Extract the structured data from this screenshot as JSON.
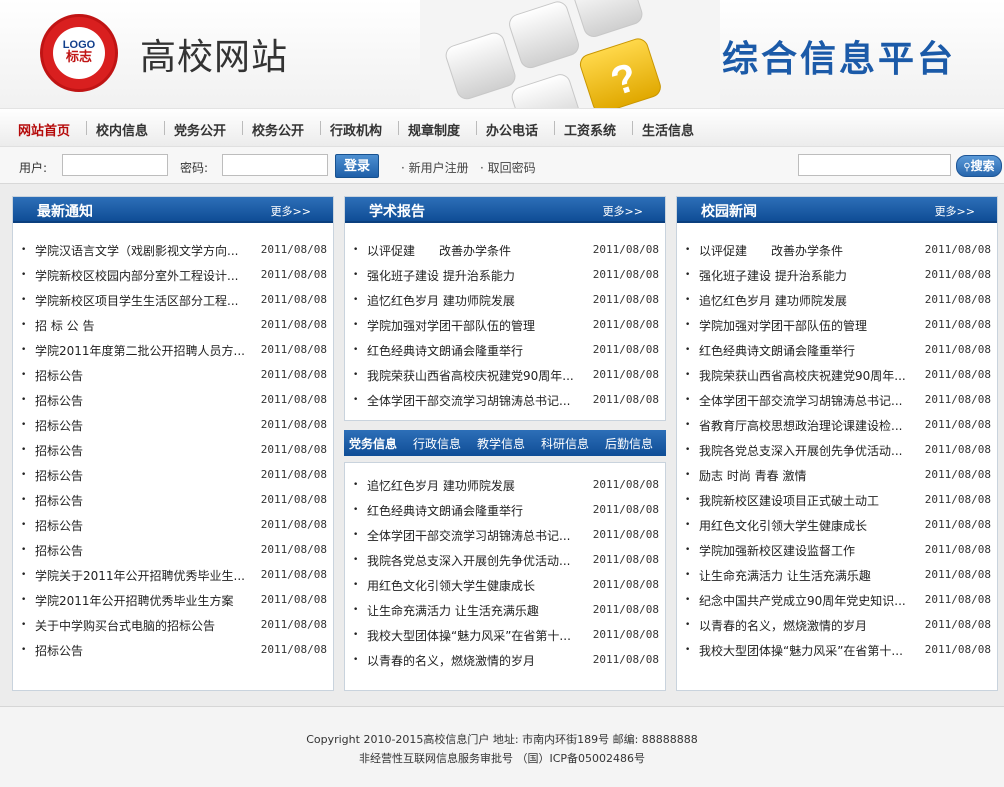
{
  "header": {
    "logo_en": "LOGO",
    "logo_cn": "标志",
    "site_name": "高校网站",
    "platform_title": "综合信息平台"
  },
  "nav": [
    "网站首页",
    "校内信息",
    "党务公开",
    "校务公开",
    "行政机构",
    "规章制度",
    "办公电话",
    "工资系统",
    "生活信息"
  ],
  "login": {
    "user_label": "用户:",
    "password_label": "密码:",
    "login_button": "登录",
    "register_link": "· 新用户注册",
    "recover_link": "· 取回密码",
    "search_button": "搜索"
  },
  "panels": {
    "notices": {
      "title": "最新通知",
      "more": "更多>>",
      "items": [
        {
          "title": "学院汉语言文学（戏剧影视文学方向...",
          "date": "2011/08/08"
        },
        {
          "title": "学院新校区校园内部分室外工程设计...",
          "date": "2011/08/08"
        },
        {
          "title": "学院新校区项目学生生活区部分工程...",
          "date": "2011/08/08"
        },
        {
          "title": "招 标 公 告",
          "date": "2011/08/08"
        },
        {
          "title": "学院2011年度第二批公开招聘人员方...",
          "date": "2011/08/08"
        },
        {
          "title": "招标公告",
          "date": "2011/08/08"
        },
        {
          "title": "招标公告",
          "date": "2011/08/08"
        },
        {
          "title": "招标公告",
          "date": "2011/08/08"
        },
        {
          "title": "招标公告",
          "date": "2011/08/08"
        },
        {
          "title": "招标公告",
          "date": "2011/08/08"
        },
        {
          "title": "招标公告",
          "date": "2011/08/08"
        },
        {
          "title": "招标公告",
          "date": "2011/08/08"
        },
        {
          "title": "招标公告",
          "date": "2011/08/08"
        },
        {
          "title": "学院关于2011年公开招聘优秀毕业生...",
          "date": "2011/08/08"
        },
        {
          "title": "学院2011年公开招聘优秀毕业生方案",
          "date": "2011/08/08"
        },
        {
          "title": "关于中学购买台式电脑的招标公告",
          "date": "2011/08/08"
        },
        {
          "title": "招标公告",
          "date": "2011/08/08"
        }
      ]
    },
    "academic": {
      "title": "学术报告",
      "more": "更多>>",
      "items": [
        {
          "title": "以评促建　　改善办学条件",
          "date": "2011/08/08"
        },
        {
          "title": "强化班子建设 提升治系能力",
          "date": "2011/08/08"
        },
        {
          "title": "追忆红色岁月 建功师院发展",
          "date": "2011/08/08"
        },
        {
          "title": "学院加强对学团干部队伍的管理",
          "date": "2011/08/08"
        },
        {
          "title": "红色经典诗文朗诵会隆重举行",
          "date": "2011/08/08"
        },
        {
          "title": "我院荣获山西省高校庆祝建党90周年...",
          "date": "2011/08/08"
        },
        {
          "title": "全体学团干部交流学习胡锦涛总书记...",
          "date": "2011/08/08"
        }
      ]
    },
    "tabs": {
      "labels": [
        "党务信息",
        "行政信息",
        "教学信息",
        "科研信息",
        "后勤信息"
      ],
      "items": [
        {
          "title": "追忆红色岁月 建功师院发展",
          "date": "2011/08/08"
        },
        {
          "title": "红色经典诗文朗诵会隆重举行",
          "date": "2011/08/08"
        },
        {
          "title": "全体学团干部交流学习胡锦涛总书记...",
          "date": "2011/08/08"
        },
        {
          "title": "我院各党总支深入开展创先争优活动...",
          "date": "2011/08/08"
        },
        {
          "title": "用红色文化引领大学生健康成长",
          "date": "2011/08/08"
        },
        {
          "title": "让生命充满活力 让生活充满乐趣",
          "date": "2011/08/08"
        },
        {
          "title": "我校大型团体操“魅力风采”在省第十...",
          "date": "2011/08/08"
        },
        {
          "title": "以青春的名义，燃烧激情的岁月",
          "date": "2011/08/08"
        }
      ]
    },
    "campus": {
      "title": "校园新闻",
      "more": "更多>>",
      "items": [
        {
          "title": "以评促建　　改善办学条件",
          "date": "2011/08/08"
        },
        {
          "title": "强化班子建设 提升治系能力",
          "date": "2011/08/08"
        },
        {
          "title": "追忆红色岁月 建功师院发展",
          "date": "2011/08/08"
        },
        {
          "title": "学院加强对学团干部队伍的管理",
          "date": "2011/08/08"
        },
        {
          "title": "红色经典诗文朗诵会隆重举行",
          "date": "2011/08/08"
        },
        {
          "title": "我院荣获山西省高校庆祝建党90周年...",
          "date": "2011/08/08"
        },
        {
          "title": "全体学团干部交流学习胡锦涛总书记...",
          "date": "2011/08/08"
        },
        {
          "title": "省教育厅高校思想政治理论课建设检...",
          "date": "2011/08/08"
        },
        {
          "title": "我院各党总支深入开展创先争优活动...",
          "date": "2011/08/08"
        },
        {
          "title": "励志 时尚 青春 激情",
          "date": "2011/08/08"
        },
        {
          "title": "我院新校区建设项目正式破土动工",
          "date": "2011/08/08"
        },
        {
          "title": "用红色文化引领大学生健康成长",
          "date": "2011/08/08"
        },
        {
          "title": "学院加强新校区建设监督工作",
          "date": "2011/08/08"
        },
        {
          "title": "让生命充满活力 让生活充满乐趣",
          "date": "2011/08/08"
        },
        {
          "title": "纪念中国共产党成立90周年党史知识...",
          "date": "2011/08/08"
        },
        {
          "title": "以青春的名义，燃烧激情的岁月",
          "date": "2011/08/08"
        },
        {
          "title": "我校大型团体操“魅力风采”在省第十...",
          "date": "2011/08/08"
        }
      ]
    }
  },
  "footer": {
    "line1": "Copyright 2010-2015高校信息门户 地址: 市南内环街189号 邮编: 88888888",
    "line2": "非经营性互联网信息服务审批号 （国）ICP备05002486号"
  },
  "colors": {
    "brand_blue": "#1b5aa8",
    "nav_active": "#b50a0a",
    "logo_red": "#d91f1f"
  }
}
